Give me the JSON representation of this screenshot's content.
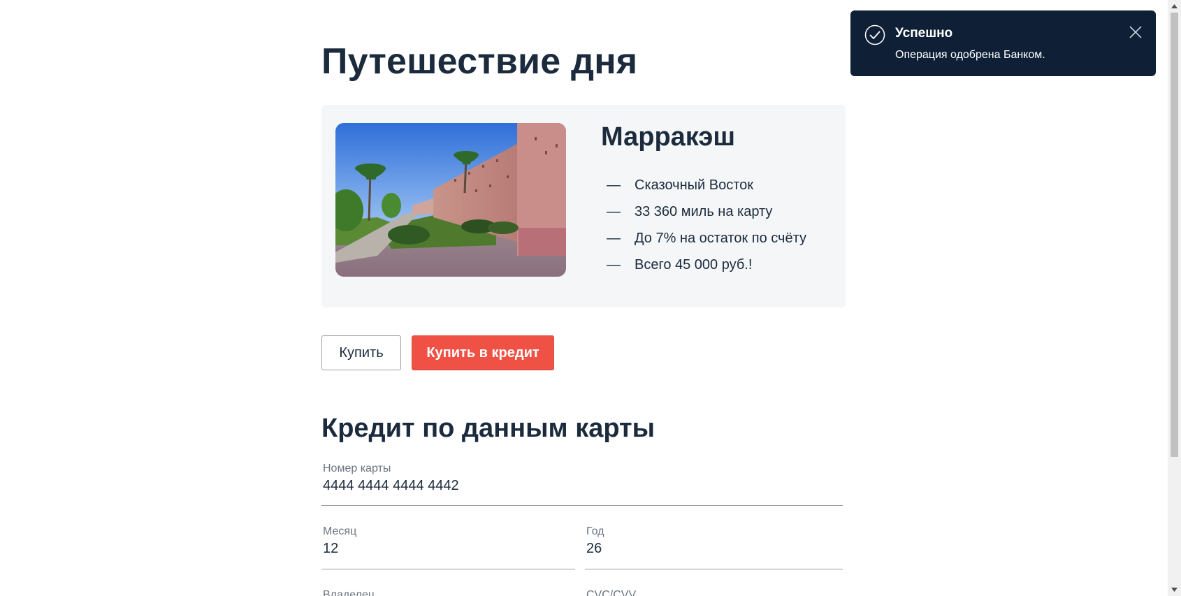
{
  "page": {
    "title": "Путешествие дня"
  },
  "offer": {
    "image_name": "marrakech-walls-photo",
    "title": "Марракэш",
    "dash": "—",
    "features": [
      "Сказочный Восток",
      "33 360 миль на карту",
      "До 7% на остаток по счёту",
      "Всего 45 000 руб.!"
    ]
  },
  "actions": {
    "buy_label": "Купить",
    "credit_label": "Купить в кредит"
  },
  "form": {
    "title": "Кредит по данным карты",
    "card_number": {
      "label": "Номер карты",
      "value": "4444 4444 4444 4442"
    },
    "month": {
      "label": "Месяц",
      "value": "12"
    },
    "year": {
      "label": "Год",
      "value": "26"
    },
    "owner": {
      "label": "Владелец",
      "value": ""
    },
    "cvc": {
      "label": "CVC/CVV",
      "value": ""
    }
  },
  "notification": {
    "title": "Успешно",
    "message": "Операция одобрена Банком.",
    "icon": "check-circle-icon",
    "close_icon": "close-icon",
    "background": "#0f2036"
  },
  "colors": {
    "accent": "#ef5245",
    "heading": "#1b2b3d",
    "card_bg": "#f5f6f7"
  }
}
